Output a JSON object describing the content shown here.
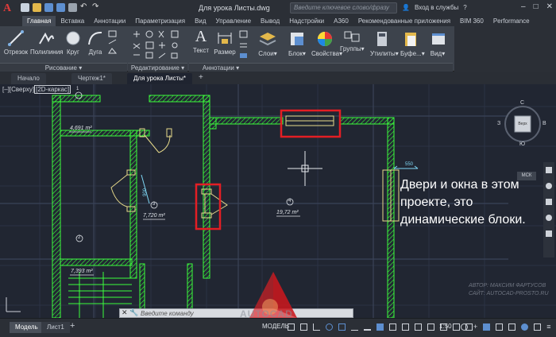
{
  "titlebar": {
    "logo": "A",
    "doc_title": "Для урока Листы.dwg",
    "search_placeholder": "Введите ключевое слово/фразу",
    "signin": "Вход в службы",
    "help": "?"
  },
  "ribbon_tabs": [
    "Главная",
    "Вставка",
    "Аннотации",
    "Параметризация",
    "Вид",
    "Управление",
    "Вывод",
    "Надстройки",
    "A360",
    "Рекомендованные приложения",
    "BIM 360",
    "Performance"
  ],
  "ribbon": {
    "draw_tools": [
      "Отрезок",
      "Полилиния",
      "Круг",
      "Дуга"
    ],
    "annot_tools": [
      "Текст",
      "Размер"
    ],
    "big_tools": [
      "Слои",
      "Блок",
      "Свойства",
      "Группы",
      "Утилиты",
      "Буфе...",
      "Вид"
    ],
    "panels": {
      "draw": "Рисование",
      "edit": "Редактирование",
      "annotations": "Аннотации"
    }
  },
  "file_tabs": [
    "Начало",
    "Чертеж1*",
    "Для урока Листы*"
  ],
  "viewport_label": {
    "prefix": "[–][Сверху]",
    "visual": "[2D-каркас]"
  },
  "viewcube": {
    "north": "С",
    "south": "Ю",
    "west": "З",
    "east": "В",
    "face": "Верх",
    "wcs": "МСК"
  },
  "rooms": [
    {
      "num": "1",
      "area": "4,691 m²"
    },
    {
      "num": "3",
      "area": "7,720 m²"
    },
    {
      "num": "4",
      "area": "19,72 m²"
    },
    {
      "num": "2",
      "area": "7,393 m²"
    }
  ],
  "dimensions": {
    "door": "900",
    "window": "550"
  },
  "caption": "Двери и окна в этом проекте, это динамические блоки.",
  "watermark": [
    "АВТОР: МАКСИМ ФАРТУСОВ",
    "САЙТ: AUTOCAD-PROSTO.RU"
  ],
  "command": {
    "placeholder": "Введите команду"
  },
  "status": {
    "layout_tabs": [
      "Модель",
      "Лист1"
    ],
    "add_tab": "+",
    "model": "МОДЕЛЬ",
    "scale": "1:50"
  },
  "logo_text": "AUTOCAD",
  "colors": {
    "wall": "#3cff3c",
    "highlight": "#e31e24",
    "background": "#212632"
  }
}
